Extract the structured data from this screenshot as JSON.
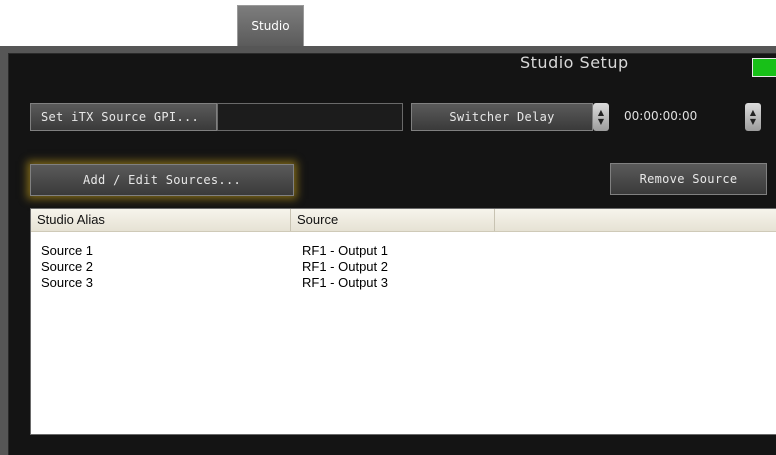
{
  "tabs": [
    {
      "label": "Studio"
    }
  ],
  "panel": {
    "title": "Studio Setup",
    "status_color": "#18c018"
  },
  "toolbar": {
    "set_gpi_label": "Set iTX Source GPI...",
    "gpi_value": "",
    "switcher_delay_label": "Switcher Delay",
    "delay_value": "00:00:00:00",
    "add_edit_label": "Add / Edit Sources...",
    "remove_label": "Remove Source"
  },
  "table": {
    "columns": [
      "Studio Alias",
      "Source",
      ""
    ],
    "rows": [
      {
        "alias": "Source 1",
        "source": "RF1 - Output 1"
      },
      {
        "alias": "Source 2",
        "source": "RF1 - Output 2"
      },
      {
        "alias": "Source 3",
        "source": "RF1 - Output 3"
      }
    ]
  },
  "icons": {
    "spinner": "up-down-spinner-icon",
    "status": "status-led-icon"
  }
}
